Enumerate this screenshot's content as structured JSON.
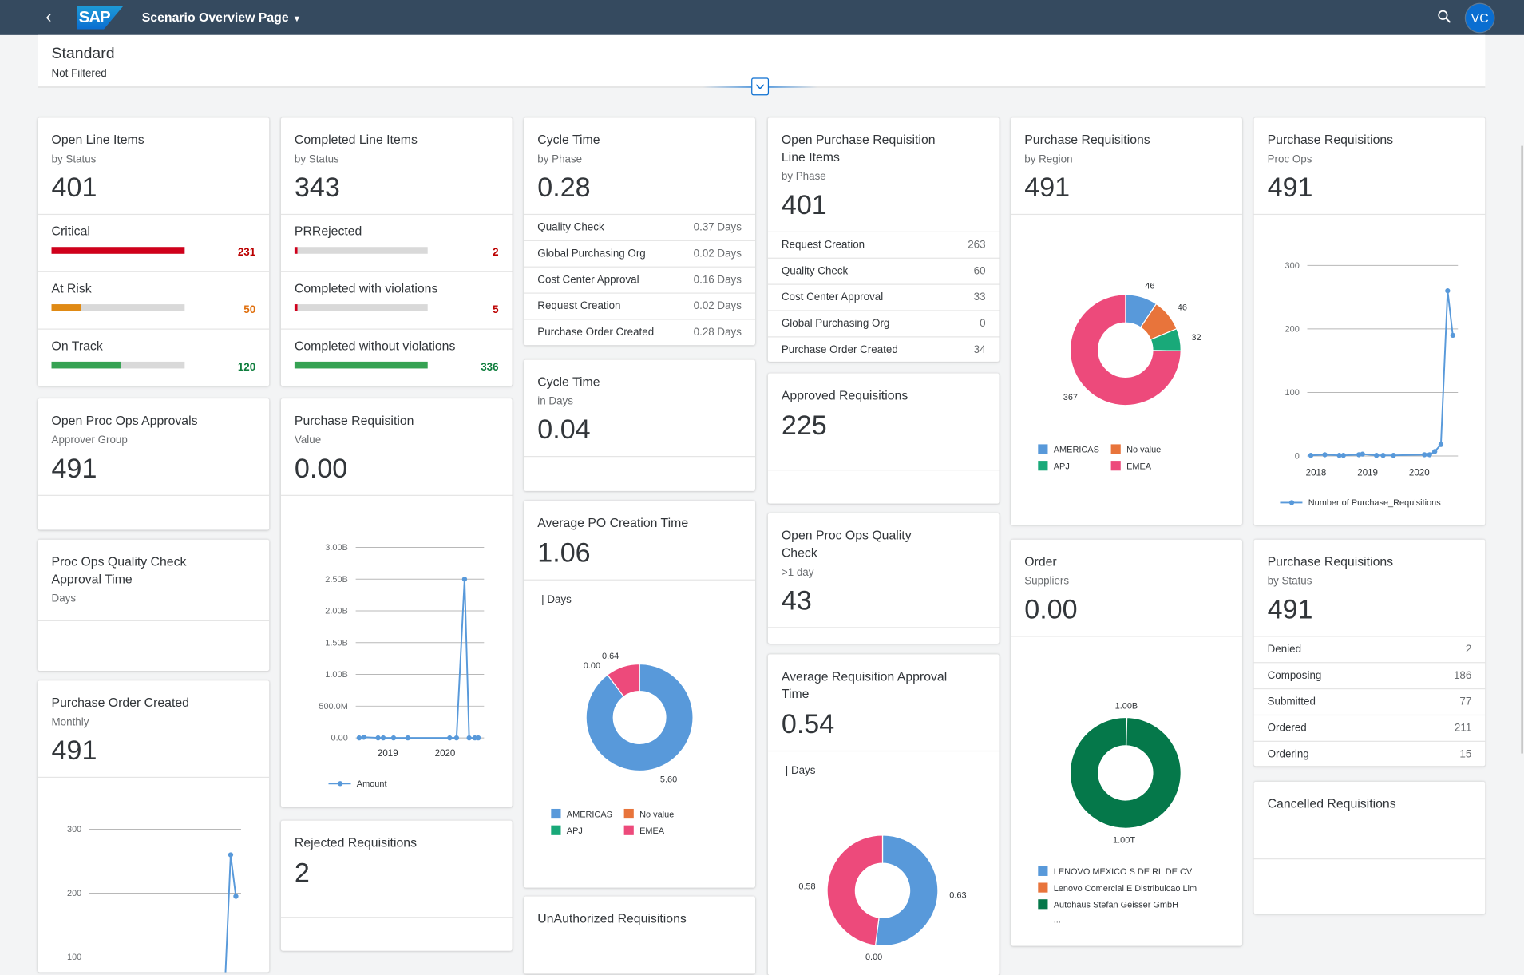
{
  "shell": {
    "title": "Scenario Overview Page",
    "logo": "SAP",
    "avatar": "VC",
    "back_icon": "chevron-left-icon",
    "search_icon": "search-icon",
    "caret_icon": "caret-down-icon",
    "color": "#354a5f"
  },
  "filter": {
    "variant": "Standard",
    "status": "Not Filtered",
    "toggle_icon": "chevron-down-icon"
  },
  "colors": {
    "critical": "#d0001b",
    "risk": "#e08a14",
    "good": "#36a253",
    "blue": "#5899da",
    "orange": "#e8743b",
    "green": "#19a979",
    "pink": "#ed4a7b",
    "darkgreen": "#05784a"
  },
  "cards": [
    {
      "id": "open-line-items",
      "type": "progress",
      "title": "Open Line Items",
      "subtitle": "by Status",
      "kpi": "401",
      "rows": [
        {
          "label": "Critical",
          "value": 231,
          "color": "#d0001b",
          "fraction": 1
        },
        {
          "label": "At Risk",
          "value": 50,
          "color": "#e08a14",
          "fraction": 0.216
        },
        {
          "label": "On Track",
          "value": 120,
          "color": "#36a253",
          "fraction": 0.52
        }
      ]
    },
    {
      "id": "open-proc-ops-approvals",
      "type": "kpi",
      "title": "Open Proc Ops Approvals",
      "subtitle": "Approver Group",
      "kpi": "491"
    },
    {
      "id": "proc-ops-quality-check-approval-time",
      "type": "kpi",
      "title": "Proc Ops Quality Check Approval Time",
      "subtitle": "Days",
      "kpi": ""
    },
    {
      "id": "purchase-order-created",
      "type": "line",
      "title": "Purchase Order Created",
      "subtitle": "Monthly",
      "kpi": "491",
      "chart_data": {
        "type": "line",
        "ylim": [
          0,
          300
        ],
        "yticks": [
          {
            "v": 100,
            "label": "100"
          },
          {
            "v": 200,
            "label": "200"
          },
          {
            "v": 300,
            "label": "300"
          }
        ],
        "xlim": [
          2017.83,
          2020.75
        ],
        "xticks": [],
        "series": [
          {
            "points": [
              [
                2020.42,
                18
              ],
              [
                2020.55,
                260
              ],
              [
                2020.65,
                195
              ]
            ]
          }
        ],
        "legend": ""
      }
    },
    {
      "id": "completed-line-items",
      "type": "progress",
      "title": "Completed Line Items",
      "subtitle": "by Status",
      "kpi": "343",
      "rows": [
        {
          "label": "PRRejected",
          "value": 2,
          "color": "#d0001b",
          "fraction": 0.006
        },
        {
          "label": "Completed with violations",
          "value": 5,
          "color": "#d0001b",
          "fraction": 0.015
        },
        {
          "label": "Completed without violations",
          "value": 336,
          "color": "#36a253",
          "fraction": 1
        }
      ]
    },
    {
      "id": "purchase-requisition-value",
      "type": "line",
      "title": "Purchase Requisition",
      "subtitle": "Value",
      "kpi": "0.00",
      "chart_data": {
        "type": "line",
        "ylim": [
          0,
          3000000000
        ],
        "yticks": [
          {
            "v": 0,
            "label": "0.00"
          },
          {
            "v": 500000000,
            "label": "500.0M"
          },
          {
            "v": 1000000000,
            "label": "1.00B"
          },
          {
            "v": 1500000000,
            "label": "1.50B"
          },
          {
            "v": 2000000000,
            "label": "2.00B"
          },
          {
            "v": 2500000000,
            "label": "2.50B"
          },
          {
            "v": 3000000000,
            "label": "3.00B"
          }
        ],
        "xlim": [
          2018.44,
          2020.68
        ],
        "xticks": [
          {
            "v": 2019,
            "label": "2019"
          },
          {
            "v": 2020,
            "label": "2020"
          }
        ],
        "series": [
          {
            "name": "Amount",
            "points": [
              [
                2018.5,
                0
              ],
              [
                2018.58,
                10000000
              ],
              [
                2018.83,
                0
              ],
              [
                2018.92,
                0
              ],
              [
                2019.1,
                0
              ],
              [
                2019.35,
                0
              ],
              [
                2020.08,
                0
              ],
              [
                2020.2,
                0
              ],
              [
                2020.34,
                2500000000
              ],
              [
                2020.42,
                0
              ],
              [
                2020.52,
                0
              ],
              [
                2020.58,
                0
              ]
            ]
          }
        ],
        "legend": "Amount"
      }
    },
    {
      "id": "rejected-requisitions",
      "type": "kpi",
      "title": "Rejected Requisitions",
      "subtitle": "",
      "kpi": "2"
    },
    {
      "id": "cycle-time-by-phase",
      "type": "list",
      "title": "Cycle Time",
      "subtitle": "by Phase",
      "kpi": "0.28",
      "rows": [
        {
          "label": "Quality Check",
          "value": "0.37 Days"
        },
        {
          "label": "Global Purchasing Org",
          "value": "0.02 Days"
        },
        {
          "label": "Cost Center Approval",
          "value": "0.16 Days"
        },
        {
          "label": "Request Creation",
          "value": "0.02 Days"
        },
        {
          "label": "Purchase Order Created",
          "value": "0.28 Days"
        }
      ]
    },
    {
      "id": "cycle-time-in-days",
      "type": "kpi",
      "title": "Cycle Time",
      "subtitle": "in Days",
      "kpi": "0.04"
    },
    {
      "id": "average-po-creation-time",
      "type": "donut",
      "title": "Average PO Creation Time",
      "subtitle": "",
      "kpi": "1.06",
      "unit": "| Days",
      "chart_data": {
        "type": "pie",
        "donut": true,
        "slices": [
          {
            "name": "AMERICAS",
            "value": 5.6,
            "label": "5.60",
            "color": "#5899da"
          },
          {
            "name": "No value",
            "value": 0,
            "label": "0.00",
            "color": "#e8743b"
          },
          {
            "name": "APJ",
            "value": 0,
            "label": "",
            "color": "#19a979"
          },
          {
            "name": "EMEA",
            "value": 0.64,
            "label": "0.64",
            "color": "#ed4a7b"
          }
        ],
        "legend": [
          "AMERICAS",
          "No value",
          "APJ",
          "EMEA"
        ]
      }
    },
    {
      "id": "unauthorized-requisitions",
      "type": "kpi",
      "title": "UnAuthorized Requisitions",
      "subtitle": "",
      "kpi": ""
    },
    {
      "id": "open-purchase-requisition-line-items",
      "type": "list",
      "title": "Open Purchase Requisition Line Items",
      "subtitle": "by Phase",
      "kpi": "401",
      "rows": [
        {
          "label": "Request Creation",
          "value": "263"
        },
        {
          "label": "Quality Check",
          "value": "60"
        },
        {
          "label": "Cost Center Approval",
          "value": "33"
        },
        {
          "label": "Global Purchasing Org",
          "value": "0"
        },
        {
          "label": "Purchase Order Created",
          "value": "34"
        }
      ]
    },
    {
      "id": "approved-requisitions",
      "type": "kpi",
      "title": "Approved Requisitions",
      "subtitle": "",
      "kpi": "225"
    },
    {
      "id": "open-proc-ops-quality-check",
      "type": "kpi",
      "title": "Open Proc Ops Quality Check",
      "subtitle": ">1 day",
      "kpi": "43"
    },
    {
      "id": "average-requisition-approval-time",
      "type": "donut",
      "title": "Average Requisition Approval Time",
      "subtitle": "",
      "kpi": "0.54",
      "unit": "| Days",
      "chart_data": {
        "type": "pie",
        "donut": true,
        "slices": [
          {
            "name": "",
            "value": 0.63,
            "label": "0.63",
            "color": "#5899da"
          },
          {
            "name": "",
            "value": 0,
            "label": "0.00",
            "color": "#e8743b"
          },
          {
            "name": "",
            "value": 0.58,
            "label": "0.58",
            "color": "#ed4a7b"
          }
        ],
        "legend": []
      }
    },
    {
      "id": "purchase-requisitions-by-region",
      "type": "donut",
      "title": "Purchase Requisitions",
      "subtitle": "by Region",
      "kpi": "491",
      "chart_data": {
        "type": "pie",
        "donut": true,
        "slices": [
          {
            "name": "AMERICAS",
            "value": 46,
            "label": "46",
            "color": "#5899da"
          },
          {
            "name": "No value",
            "value": 46,
            "label": "46",
            "color": "#e8743b"
          },
          {
            "name": "APJ",
            "value": 32,
            "label": "32",
            "color": "#19a979"
          },
          {
            "name": "EMEA",
            "value": 367,
            "label": "367",
            "color": "#ed4a7b"
          }
        ],
        "legend": [
          "AMERICAS",
          "No value",
          "APJ",
          "EMEA"
        ]
      }
    },
    {
      "id": "order-suppliers",
      "type": "donut",
      "title": "Order",
      "subtitle": "Suppliers",
      "kpi": "0.00",
      "chart_data": {
        "type": "pie",
        "donut": true,
        "slices": [
          {
            "name": "LENOVO MEXICO S DE RL DE CV",
            "value": 1000000000,
            "label": "1.00B",
            "color": "#5899da"
          },
          {
            "name": "Lenovo Comercial E Distribuicao Lim",
            "value": 0,
            "label": "",
            "color": "#e8743b"
          },
          {
            "name": "Autohaus Stefan Geisser GmbH",
            "value": 1000000000000,
            "label": "1.00T",
            "color": "#05784a"
          }
        ],
        "legend": [
          "LENOVO MEXICO S DE RL DE CV",
          "Lenovo Comercial E Distribuicao Lim",
          "Autohaus Stefan Geisser GmbH"
        ],
        "legend_more": "..."
      }
    },
    {
      "id": "purchase-requisitions-proc-ops",
      "type": "line",
      "title": "Purchase Requisitions",
      "subtitle": "Proc Ops",
      "kpi": "491",
      "chart_data": {
        "type": "line",
        "ylim": [
          0,
          300
        ],
        "yticks": [
          {
            "v": 0,
            "label": "0"
          },
          {
            "v": 100,
            "label": "100"
          },
          {
            "v": 200,
            "label": "200"
          },
          {
            "v": 300,
            "label": "300"
          }
        ],
        "xlim": [
          2017.83,
          2020.75
        ],
        "xticks": [
          {
            "v": 2018,
            "label": "2018"
          },
          {
            "v": 2019,
            "label": "2019"
          },
          {
            "v": 2020,
            "label": "2020"
          }
        ],
        "series": [
          {
            "name": "Number of Purchase_Requisitions",
            "points": [
              [
                2017.9,
                1
              ],
              [
                2018.17,
                2
              ],
              [
                2018.45,
                1
              ],
              [
                2018.53,
                1
              ],
              [
                2018.83,
                2
              ],
              [
                2018.9,
                3
              ],
              [
                2019.17,
                1
              ],
              [
                2019.3,
                1
              ],
              [
                2019.5,
                1
              ],
              [
                2020.1,
                2
              ],
              [
                2020.2,
                2
              ],
              [
                2020.3,
                7
              ],
              [
                2020.42,
                18
              ],
              [
                2020.55,
                260
              ],
              [
                2020.65,
                190
              ]
            ]
          }
        ],
        "legend": "Number of Purchase_Requisitions"
      }
    },
    {
      "id": "purchase-requisitions-by-status",
      "type": "list",
      "title": "Purchase Requisitions",
      "subtitle": "by Status",
      "kpi": "491",
      "rows": [
        {
          "label": "Denied",
          "value": "2"
        },
        {
          "label": "Composing",
          "value": "186"
        },
        {
          "label": "Submitted",
          "value": "77"
        },
        {
          "label": "Ordered",
          "value": "211"
        },
        {
          "label": "Ordering",
          "value": "15"
        }
      ]
    },
    {
      "id": "cancelled-requisitions",
      "type": "kpi",
      "title": "Cancelled Requisitions",
      "subtitle": "",
      "kpi": ""
    }
  ]
}
